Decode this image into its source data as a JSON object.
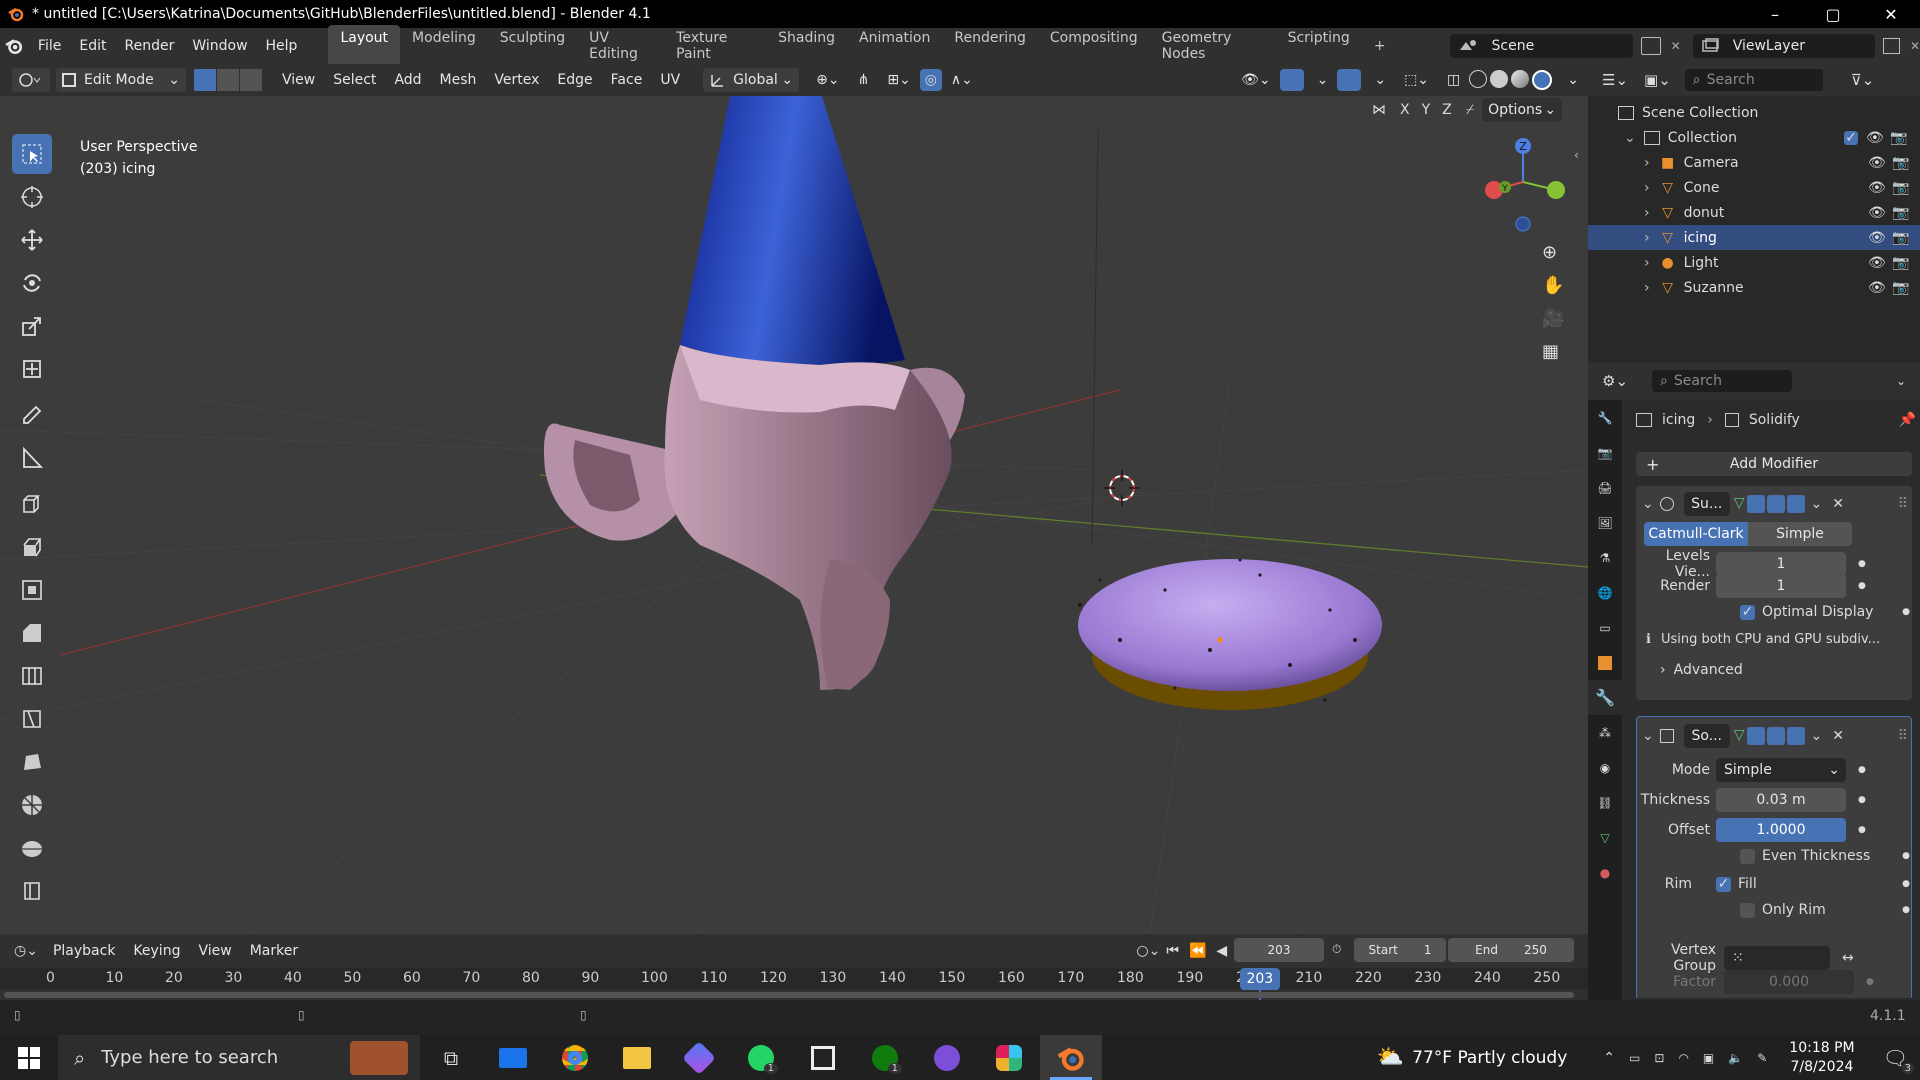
{
  "window": {
    "title": "* untitled [C:\\Users\\Katrina\\Documents\\GitHub\\BlenderFiles\\untitled.blend] - Blender 4.1",
    "minimize": "–",
    "maximize": "▢",
    "close": "✕"
  },
  "menus": [
    "File",
    "Edit",
    "Render",
    "Window",
    "Help"
  ],
  "workspaces": [
    "Layout",
    "Modeling",
    "Sculpting",
    "UV Editing",
    "Texture Paint",
    "Shading",
    "Animation",
    "Rendering",
    "Compositing",
    "Geometry Nodes",
    "Scripting"
  ],
  "active_workspace": "Layout",
  "add_workspace": "+",
  "scene": {
    "name": "Scene",
    "view_layer": "ViewLayer"
  },
  "header": {
    "mode": "Edit Mode",
    "menus": [
      "View",
      "Select",
      "Add",
      "Mesh",
      "Vertex",
      "Edge",
      "Face",
      "UV"
    ],
    "orientation": "Global",
    "options": "Options",
    "axes": [
      "X",
      "Y",
      "Z"
    ]
  },
  "viewport": {
    "perspective": "User Perspective",
    "object_label": "(203) icing",
    "gizmo_axes": [
      "X",
      "Y",
      "Z"
    ]
  },
  "outliner": {
    "search_placeholder": "Search",
    "scene_collection": "Scene Collection",
    "collection": "Collection",
    "items": [
      {
        "name": "Camera",
        "icon": "camera-icon"
      },
      {
        "name": "Cone",
        "icon": "mesh-icon"
      },
      {
        "name": "donut",
        "icon": "mesh-icon"
      },
      {
        "name": "icing",
        "icon": "mesh-icon"
      },
      {
        "name": "Light",
        "icon": "light-icon"
      },
      {
        "name": "Suzanne",
        "icon": "mesh-icon"
      }
    ],
    "selected": "icing"
  },
  "properties": {
    "search_placeholder": "Search",
    "breadcrumb_object": "icing",
    "breadcrumb_modifier": "Solidify",
    "add_modifier": "Add Modifier",
    "subsurf": {
      "name": "Su...",
      "tabs": [
        "Catmull-Clark",
        "Simple"
      ],
      "levels_label": "Levels Vie...",
      "levels_value": "1",
      "render_label": "Render",
      "render_value": "1",
      "optimal_display": "Optimal Display",
      "info": "Using both CPU and GPU subdiv...",
      "advanced": "Advanced"
    },
    "solidify": {
      "name": "So...",
      "mode_label": "Mode",
      "mode_value": "Simple",
      "thickness_label": "Thickness",
      "thickness_value": "0.03 m",
      "offset_label": "Offset",
      "offset_value": "1.0000",
      "even_thickness": "Even Thickness",
      "rim_label": "Rim",
      "fill": "Fill",
      "only_rim": "Only Rim",
      "vertex_group_label": "Vertex Group",
      "factor_label": "Factor",
      "factor_value": "0.000"
    }
  },
  "timeline": {
    "menus": [
      "Playback",
      "Keying",
      "View",
      "Marker"
    ],
    "current_frame": "203",
    "start_label": "Start",
    "start_value": "1",
    "end_label": "End",
    "end_value": "250",
    "ticks": [
      "0",
      "10",
      "20",
      "30",
      "40",
      "50",
      "60",
      "70",
      "80",
      "90",
      "100",
      "110",
      "120",
      "130",
      "140",
      "150",
      "160",
      "170",
      "180",
      "190",
      "200",
      "210",
      "220",
      "230",
      "240",
      "250"
    ]
  },
  "status": {
    "version": "4.1.1"
  },
  "taskbar": {
    "search_placeholder": "Type here to search",
    "weather": "77°F  Partly cloudy",
    "time": "10:18 PM",
    "date": "7/8/2024",
    "notifications": "3",
    "badges": {
      "whatsapp": "1",
      "xbox": "1"
    }
  },
  "colors": {
    "accent": "#4772b3",
    "selected_row": "#334d80",
    "viewport": "#3c3c3c"
  }
}
